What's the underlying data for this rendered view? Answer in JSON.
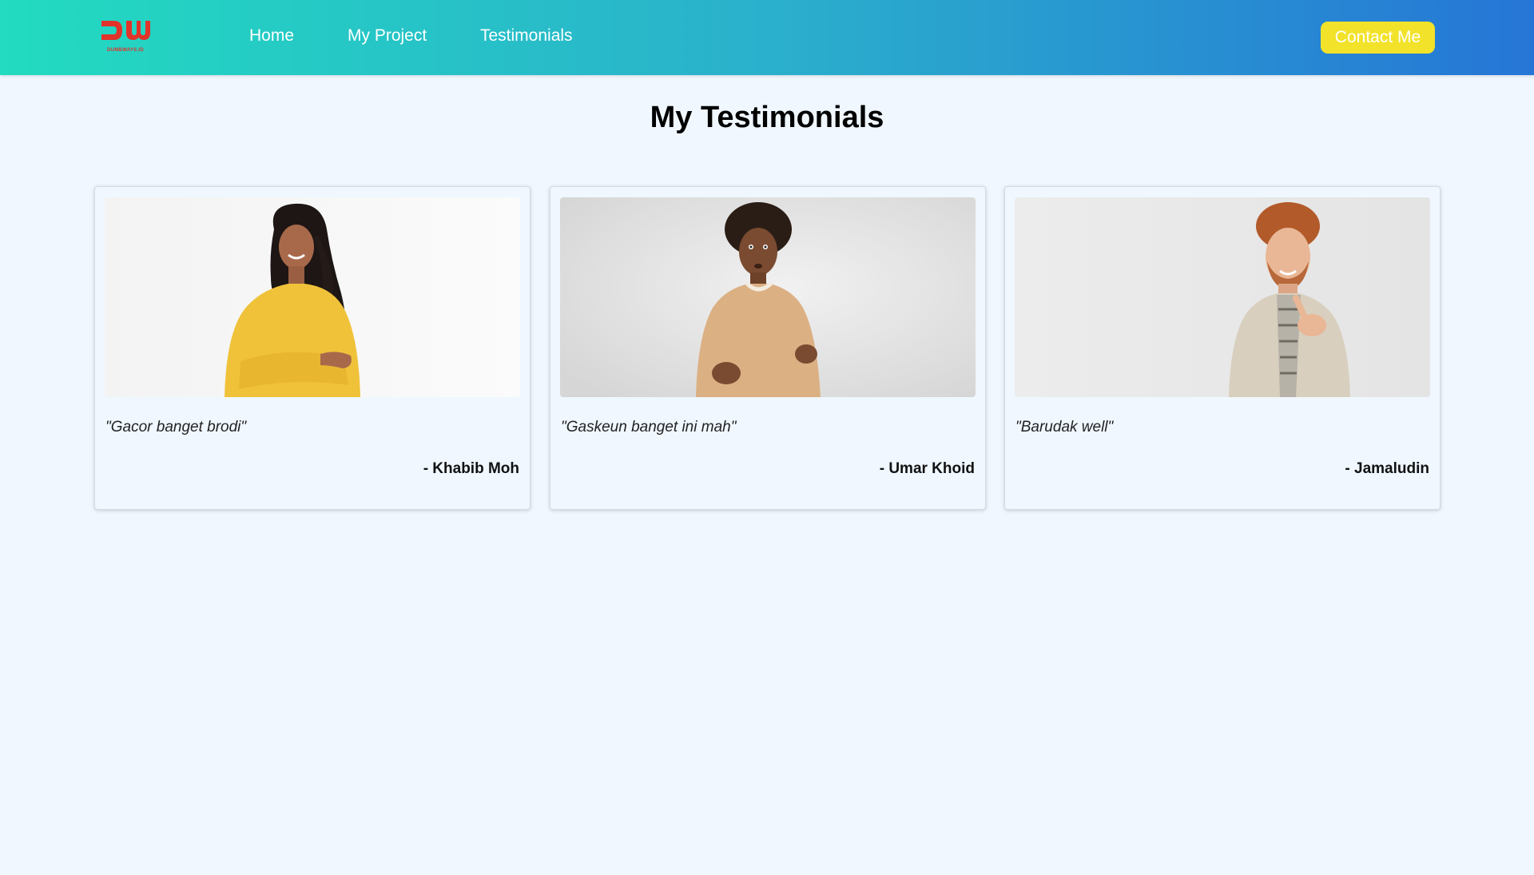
{
  "navbar": {
    "logo": {
      "mark": "DW",
      "subtitle": "DUMBWAYS.ID",
      "icon": "dumbways-logo-icon",
      "color": "#e2332a"
    },
    "links": [
      {
        "label": "Home"
      },
      {
        "label": "My Project"
      },
      {
        "label": "Testimonials"
      }
    ],
    "contact_label": "Contact Me",
    "gradient": [
      "#22dbc0",
      "#2676d6"
    ],
    "button_color": "#f2e22a"
  },
  "main": {
    "title": "My Testimonials",
    "cards": [
      {
        "photo_icon": "smiling-woman-photo",
        "quote": "\"Gacor banget brodi\"",
        "author": "- Khabib Moh"
      },
      {
        "photo_icon": "shrugging-man-photo",
        "quote": "\"Gaskeun banget ini mah\"",
        "author": "- Umar Khoid"
      },
      {
        "photo_icon": "pointing-man-photo",
        "quote": "\"Barudak well\"",
        "author": "- Jamaludin"
      }
    ]
  },
  "colors": {
    "page_background": "#f0f7ff"
  }
}
